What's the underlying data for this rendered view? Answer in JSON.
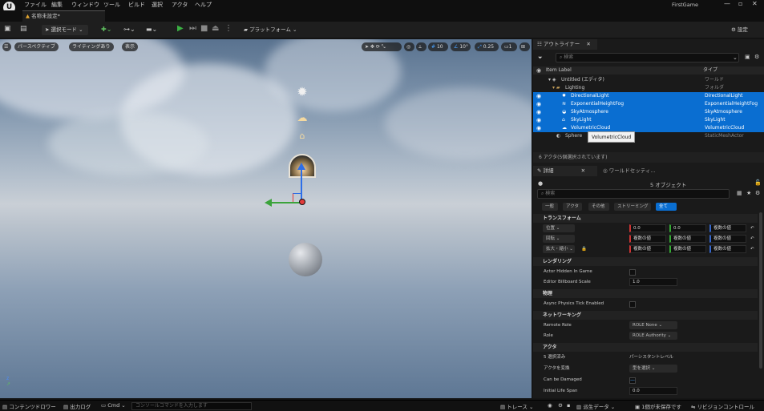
{
  "menu": [
    "ファイル",
    "編集",
    "ウィンドウ",
    "ツール",
    "ビルド",
    "選択",
    "アクタ",
    "ヘルプ"
  ],
  "project_name": "FirstGame",
  "level_tab": "名称未設定*",
  "toolbar": {
    "mode": "選択モード",
    "platforms": "プラットフォーム",
    "settings": "設定"
  },
  "viewport": {
    "perspective": "パースペクティブ",
    "lighting": "ライティングあり",
    "show": "表示",
    "grid": "10",
    "angle": "10°",
    "scale": "0.25",
    "cam": "1"
  },
  "outliner": {
    "tab": "アウトライナー",
    "search_placeholder": "検索",
    "col_label": "Item Label",
    "col_type": "タイプ",
    "rows": [
      {
        "label": "Untitled (エディタ)",
        "type": "ワールド"
      },
      {
        "label": "Lighting",
        "type": "フォルダ"
      },
      {
        "label": "DirectionalLight",
        "type": "DirectionalLight"
      },
      {
        "label": "ExponentialHeightFog",
        "type": "ExponentialHeightFog"
      },
      {
        "label": "SkyAtmosphere",
        "type": "SkyAtmosphere"
      },
      {
        "label": "SkyLight",
        "type": "SkyLight"
      },
      {
        "label": "VolumetricCloud",
        "type": "VolumetricCloud"
      },
      {
        "label": "Sphere",
        "type": "StaticMeshActor"
      }
    ],
    "tooltip": "VolumetricCloud",
    "count": "6 アクタ(5個選択されています)"
  },
  "details": {
    "tab": "詳細",
    "tab2": "ワールドセッティ...",
    "objects": "5 オブジェクト",
    "search_placeholder": "検索",
    "filters": [
      "一般",
      "アクタ",
      "その他",
      "ストリーミング",
      "全て"
    ],
    "transform": "トランスフォーム",
    "location": "位置",
    "rotation": "回転",
    "scale": "拡大・縮小",
    "loc_vals": [
      "0.0",
      "0.0",
      "複数の値"
    ],
    "rot_vals": [
      "複数の値",
      "複数の値",
      "複数の値"
    ],
    "scale_vals": [
      "複数の値",
      "複数の値",
      "複数の値"
    ],
    "rendering": "レンダリング",
    "hidden": "Actor Hidden In Game",
    "billboard": "Editor Billboard Scale",
    "billboard_val": "1.0",
    "physics": "物理",
    "async": "Async Physics Tick Enabled",
    "networking": "ネットワーキング",
    "remote_role": "Remote Role",
    "remote_role_val": "ROLE None",
    "role": "Role",
    "role_val": "ROLE Authority",
    "actor": "アクタ",
    "selected": "5 選択済み",
    "selected_val": "パーシスタントレベル",
    "convert": "アクタを変換",
    "convert_val": "型を選択",
    "damaged": "Can be Damaged",
    "lifespan": "Initial Life Span",
    "lifespan_val": "0.0"
  },
  "status": {
    "content": "コンテンツドロワー",
    "output": "出力ログ",
    "cmd": "Cmd",
    "cmd_placeholder": "コンソールコマンドを入力します",
    "trace": "トレース",
    "derived": "派生データ",
    "unsaved": "1個が未保存です",
    "revision": "リビジョンコントロール"
  },
  "colors": {
    "accent": "#0a6ed1",
    "play": "#3bb143"
  }
}
